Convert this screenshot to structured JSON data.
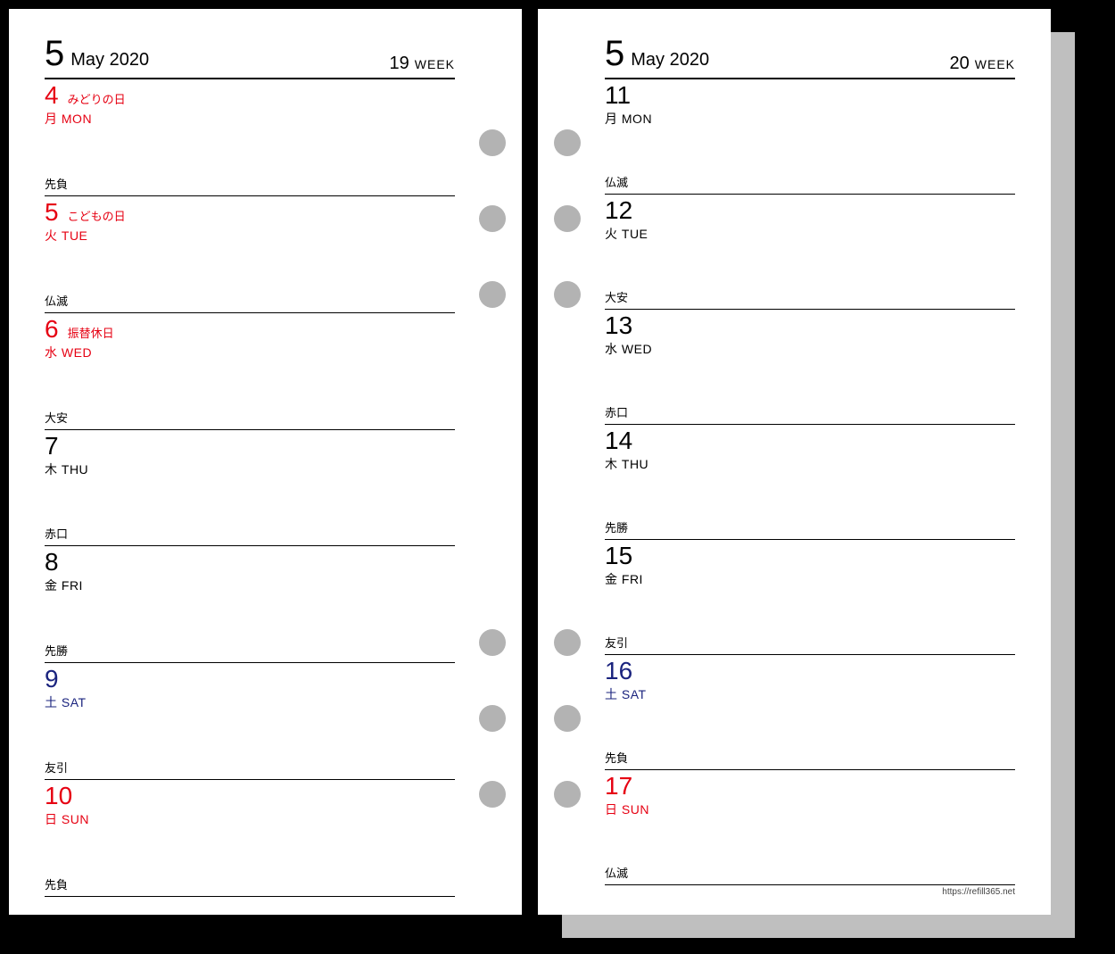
{
  "left": {
    "month_num": "5",
    "month_text": "May 2020",
    "week_num": "19",
    "week_label": "WEEK",
    "days": [
      {
        "num": "4",
        "holiday": "みどりの日",
        "dow": "月 MON",
        "rokuyo": "先負",
        "color": "red"
      },
      {
        "num": "5",
        "holiday": "こどもの日",
        "dow": "火 TUE",
        "rokuyo": "仏滅",
        "color": "red"
      },
      {
        "num": "6",
        "holiday": "振替休日",
        "dow": "水 WED",
        "rokuyo": "大安",
        "color": "red"
      },
      {
        "num": "7",
        "holiday": "",
        "dow": "木 THU",
        "rokuyo": "赤口",
        "color": ""
      },
      {
        "num": "8",
        "holiday": "",
        "dow": "金 FRI",
        "rokuyo": "先勝",
        "color": ""
      },
      {
        "num": "9",
        "holiday": "",
        "dow": "土 SAT",
        "rokuyo": "友引",
        "color": "blue"
      },
      {
        "num": "10",
        "holiday": "",
        "dow": "日 SUN",
        "rokuyo": "先負",
        "color": "red"
      }
    ]
  },
  "right": {
    "month_num": "5",
    "month_text": "May 2020",
    "week_num": "20",
    "week_label": "WEEK",
    "footer_url": "https://refill365.net",
    "days": [
      {
        "num": "11",
        "holiday": "",
        "dow": "月 MON",
        "rokuyo": "仏滅",
        "color": ""
      },
      {
        "num": "12",
        "holiday": "",
        "dow": "火 TUE",
        "rokuyo": "大安",
        "color": ""
      },
      {
        "num": "13",
        "holiday": "",
        "dow": "水 WED",
        "rokuyo": "赤口",
        "color": ""
      },
      {
        "num": "14",
        "holiday": "",
        "dow": "木 THU",
        "rokuyo": "先勝",
        "color": ""
      },
      {
        "num": "15",
        "holiday": "",
        "dow": "金 FRI",
        "rokuyo": "友引",
        "color": ""
      },
      {
        "num": "16",
        "holiday": "",
        "dow": "土 SAT",
        "rokuyo": "先負",
        "color": "blue"
      },
      {
        "num": "17",
        "holiday": "",
        "dow": "日 SUN",
        "rokuyo": "仏滅",
        "color": "red"
      }
    ]
  },
  "hole_positions": [
    135,
    220,
    305,
    695,
    780,
    865
  ]
}
